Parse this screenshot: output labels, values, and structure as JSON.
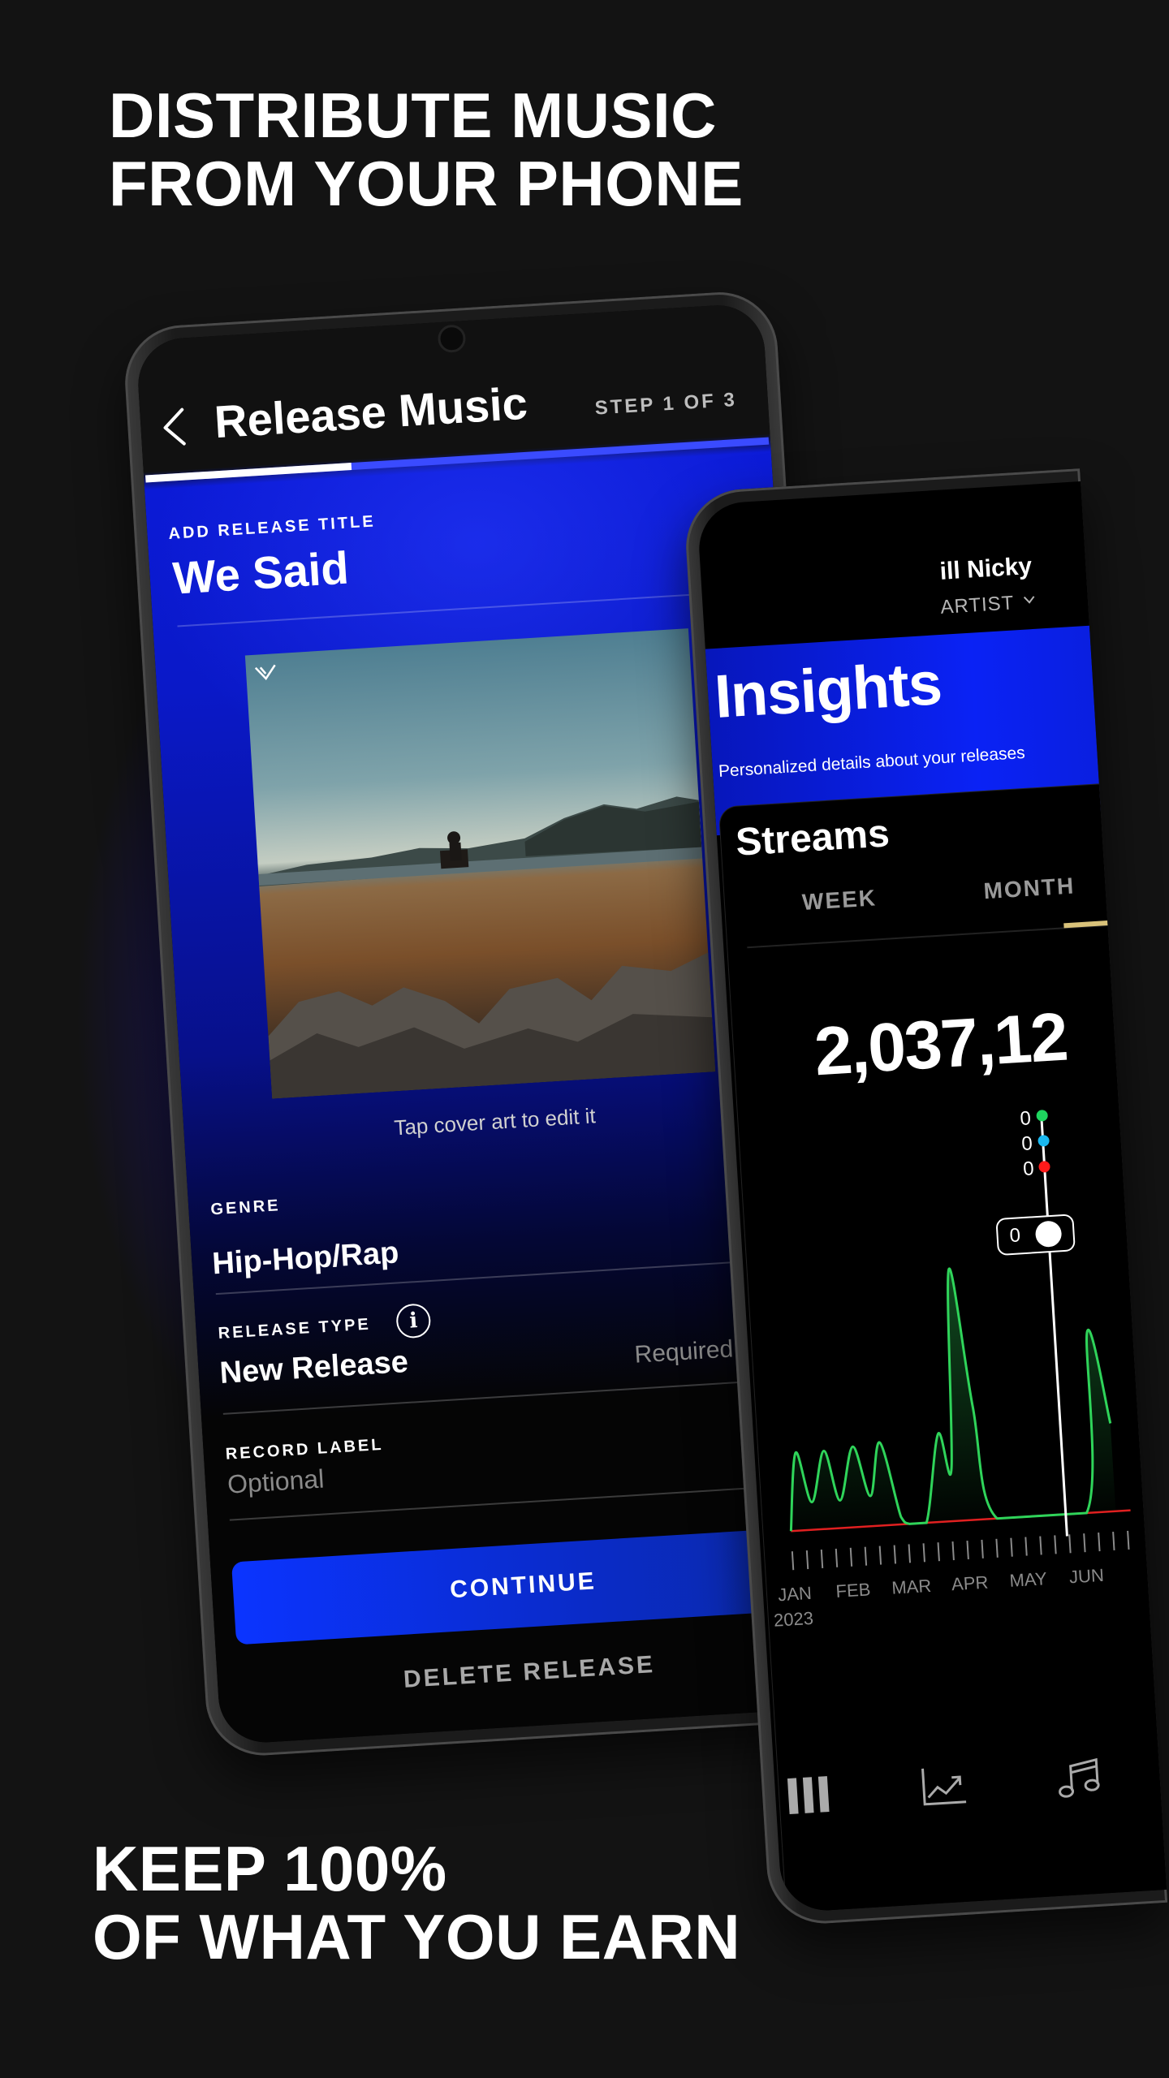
{
  "headline_top": [
    "DISTRIBUTE MUSIC",
    "FROM YOUR PHONE"
  ],
  "headline_bottom": [
    "KEEP 100%",
    "OF WHAT YOU EARN"
  ],
  "release_screen": {
    "title": "Release Music",
    "step": "STEP 1 OF 3",
    "progress_fraction": 0.33,
    "release_title_label": "ADD RELEASE TITLE",
    "release_title_value": "We Said",
    "cover_hint": "Tap cover art to edit it",
    "genre_label": "GENRE",
    "genre_value": "Hip-Hop/Rap",
    "release_type_label": "RELEASE TYPE",
    "release_type_value": "New Release",
    "release_type_hint": "Required",
    "record_label_label": "RECORD LABEL",
    "record_label_placeholder": "Optional",
    "continue_label": "CONTINUE",
    "delete_label": "DELETE RELEASE",
    "colors": {
      "accent": "#0a2bff",
      "progress_track": "#3a4bff"
    }
  },
  "insights_screen": {
    "artist_name": "ill Nicky",
    "role": "ARTIST",
    "title": "Insights",
    "subtitle": "Personalized details about your releases",
    "card_title": "Streams",
    "tabs": [
      {
        "label": "WEEK"
      },
      {
        "label": "MONTH"
      }
    ],
    "total": "2,037,12",
    "tooltip": {
      "values": [
        "0",
        "0",
        "0"
      ],
      "pill_value": "0",
      "dot_colors": [
        "#1fd65f",
        "#1ab8f0",
        "#ff1a1a"
      ]
    },
    "nav_icons": [
      "library-icon",
      "chart-icon",
      "music-note-icon"
    ],
    "colors": {
      "line": "#2fd45a",
      "baseline": "#e02020",
      "tab_indicator": "#d9c27a"
    }
  },
  "chart_data": {
    "type": "area",
    "x_labels": [
      "JAN",
      "FEB",
      "MAR",
      "APR",
      "MAY",
      "JUN"
    ],
    "year_label": "2023",
    "y_axis_labels": false,
    "grid": false,
    "cursor_date": "2023-05-23",
    "series": [
      {
        "points": [
          [
            "2023-01-01",
            0
          ],
          [
            "2023-01-06",
            31
          ],
          [
            "2023-01-13",
            11
          ],
          [
            "2023-01-21",
            31
          ],
          [
            "2023-01-28",
            11
          ],
          [
            "2023-02-05",
            32
          ],
          [
            "2023-02-12",
            12
          ],
          [
            "2023-02-18",
            33
          ],
          [
            "2023-02-26",
            3
          ],
          [
            "2023-03-02",
            0
          ],
          [
            "2023-03-11",
            0
          ],
          [
            "2023-03-20",
            35
          ],
          [
            "2023-03-26",
            21
          ],
          [
            "2023-03-31",
            100
          ],
          [
            "2023-04-08",
            45
          ],
          [
            "2023-04-17",
            0
          ],
          [
            "2023-06-03",
            0
          ],
          [
            "2023-06-09",
            72
          ],
          [
            "2023-06-18",
            35
          ]
        ]
      }
    ]
  }
}
